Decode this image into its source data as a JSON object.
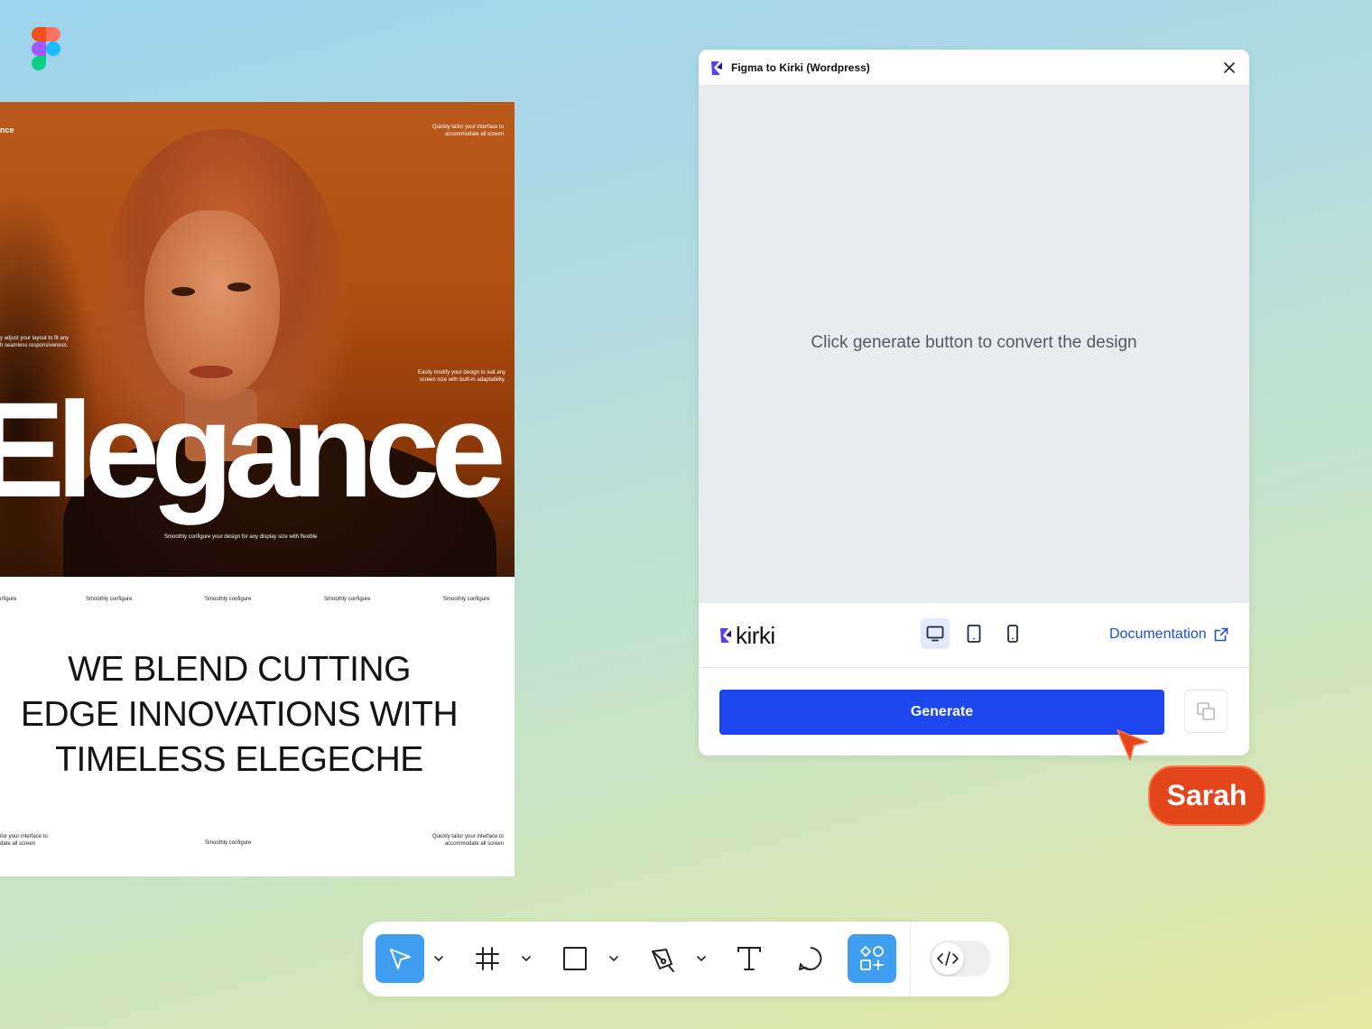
{
  "colors": {
    "accent": "#1d46ef",
    "toolbar_active": "#3f9eef",
    "cursor": "#e3461a",
    "link": "#1f4ed8"
  },
  "canvas": {
    "design": {
      "hero_brand": "nce",
      "top_right_text": "Quickly tailor your interface to\naccommodate all screen",
      "left_mid_text": "y adjust your layout to fit any\nh seamless responsiveness.",
      "right_mid_text": "Easily modify your design to suit any\nscreen size with built-in adaptability.",
      "big_word": "Elegance",
      "hero_caption": "Smoothly configure your design for any display size with flexible",
      "strip_items": [
        "nfigure",
        "Smoothly configure",
        "Smoothly configure",
        "Smoothly configure",
        "Smoothly configure"
      ],
      "headline": "WE BLEND CUTTING\nEDGE INNOVATIONS WITH\nTIMELESS ELEGECHE",
      "footer_left": "ilor your interface to\ndate all screen",
      "footer_center": "Smoothly configure",
      "footer_right": "Quickly tailor your interface to\naccommodate all screen"
    }
  },
  "plugin": {
    "title": "Figma to Kirki (Wordpress)",
    "preview_message": "Click generate button to convert the design",
    "brand": "kirki",
    "devices": [
      {
        "name": "desktop",
        "icon": "monitor-icon",
        "active": true
      },
      {
        "name": "tablet",
        "icon": "tablet-icon",
        "active": false
      },
      {
        "name": "mobile",
        "icon": "phone-icon",
        "active": false
      }
    ],
    "documentation_label": "Documentation",
    "generate_label": "Generate"
  },
  "collaborator": {
    "name": "Sarah"
  },
  "toolbar": {
    "tools": [
      {
        "name": "move",
        "icon": "move-cursor-icon",
        "active": true
      },
      {
        "name": "frame",
        "icon": "frame-icon",
        "active": false
      },
      {
        "name": "rectangle",
        "icon": "rectangle-icon",
        "active": false
      },
      {
        "name": "pen",
        "icon": "pen-icon",
        "active": false
      },
      {
        "name": "text",
        "icon": "text-icon",
        "active": false
      },
      {
        "name": "comment",
        "icon": "comment-icon",
        "active": false
      },
      {
        "name": "assets",
        "icon": "assets-icon",
        "active": true
      }
    ],
    "dev_mode_icon": "code-icon"
  }
}
